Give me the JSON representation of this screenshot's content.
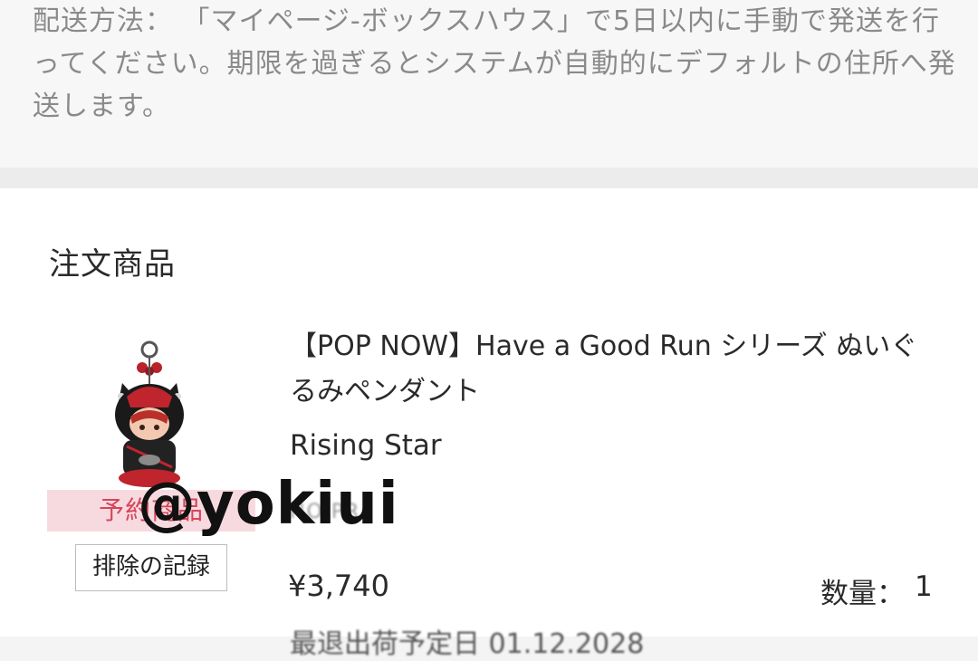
{
  "shipping_note": {
    "text": "配送方法： 「マイページ-ボックスハウス」で5日以内に手動で発送を行ってください。期限を過ぎるとシステムが自動的にデフォルトの住所へ発送します。"
  },
  "order_section": {
    "title": "注文商品",
    "watermark": "@yokiui",
    "product": {
      "title": "【POP NOW】Have a Good Run シリーズ ぬいぐるみペンダント",
      "variant": "Rising Star",
      "number_prefix": "NO.PR",
      "price": "¥3,740",
      "quantity_label": "数量：",
      "quantity_value": "1",
      "badge": "予約商品",
      "exclude_record_label": "排除の記録",
      "cutoff_text": "最退出荷予定日 01.12.2028"
    }
  },
  "colors": {
    "badge_bg": "#f7dadf",
    "badge_text": "#d6455a",
    "note_text": "#8a8a8a",
    "card_bg": "#ffffff"
  }
}
